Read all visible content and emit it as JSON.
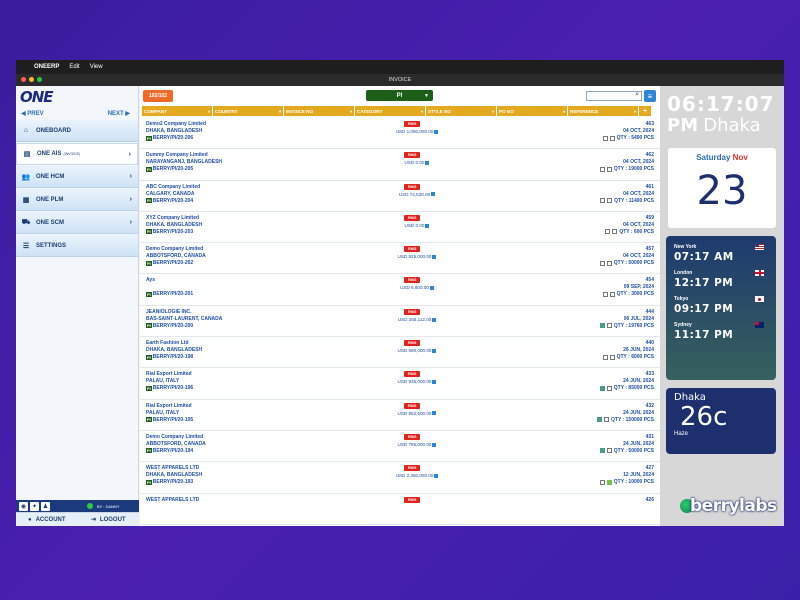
{
  "menubar": {
    "apple": "",
    "app": "ONEERP",
    "items": [
      "Edit",
      "View"
    ]
  },
  "window": {
    "title": "INVOICE"
  },
  "sidebar": {
    "logo": "ONE",
    "prev": "◀ PREV",
    "next": "NEXT ▶",
    "items": [
      {
        "label": "ONEBOARD",
        "icon": "home-icon"
      },
      {
        "label": "ONE AIS",
        "sub": "(INVOICE)",
        "icon": "document-icon"
      },
      {
        "label": "ONE HCM",
        "icon": "people-icon"
      },
      {
        "label": "ONE PLM",
        "icon": "factory-icon"
      },
      {
        "label": "ONE SCM",
        "icon": "truck-icon"
      },
      {
        "label": "SETTINGS",
        "icon": "sliders-icon"
      }
    ],
    "user": "BY : DANNY",
    "account": "ACCOUNT",
    "logout": "LOGOUT"
  },
  "toolbar": {
    "count": "102/102",
    "type": "PI",
    "search_placeholder": ""
  },
  "columns": [
    "COMPANY",
    "COUNTRY",
    "INVOICE NO",
    "CATEGORY",
    "STYLE NO",
    "PO NO",
    "REFERENCE"
  ],
  "rows": [
    {
      "company": "Demo2 Company Limited",
      "city": "DHAKA, BANGLADESH",
      "ref": "BERRY/PI/20-206",
      "badge": "RMG",
      "amount": "USD 1,080,000.00",
      "num": "463",
      "date": "04 OCT, 2024",
      "qty": "QTY : 5400 PCS",
      "status": [
        "",
        ""
      ]
    },
    {
      "company": "Dummy Company Limited",
      "city": "NARAYANGANJ, BANGLADESH",
      "ref": "BERRY/PI/20-205",
      "badge": "RMG",
      "amount": "USD 0.00",
      "num": "462",
      "date": "04 OCT, 2024",
      "qty": "QTY : 19000 PCS",
      "status": [
        "",
        ""
      ]
    },
    {
      "company": "ABC Company Limited",
      "city": "CALGARY, CANADA",
      "ref": "BERRY/PI/20-204",
      "badge": "RMG",
      "amount": "USD 74,530.00",
      "num": "461",
      "date": "04 OCT, 2024",
      "qty": "QTY : 11400 PCS",
      "status": [
        "",
        ""
      ]
    },
    {
      "company": "XYZ Company Limited",
      "city": "DHAKA, BANGLADESH",
      "ref": "BERRY/PI/20-203",
      "badge": "RMG",
      "amount": "USD 0.00",
      "num": "459",
      "date": "04 OCT, 2024",
      "qty": "QTY : 600 PCS",
      "status": [
        "",
        ""
      ]
    },
    {
      "company": "Demo Company Limited",
      "city": "ABBOTSFORD, CANADA",
      "ref": "BERRY/PI/20-202",
      "badge": "RMG",
      "amount": "USD 825,000.00",
      "num": "457",
      "date": "04 OCT, 2024",
      "qty": "QTY : 50000 PCS",
      "status": [
        "",
        ""
      ]
    },
    {
      "company": "Ays",
      "city": "",
      "ref": "BERRY/PI/20-201",
      "badge": "RMG",
      "amount": "USD 6,600.00",
      "num": "454",
      "date": "09 SEP, 2024",
      "qty": "QTY : 3000 PCS",
      "status": [
        "",
        ""
      ]
    },
    {
      "company": "JEANIOLOGIE INC.",
      "city": "BAS-SAINT-LAURENT, CANADA",
      "ref": "BERRY/PI/20-200",
      "badge": "RMG",
      "amount": "USD 255,112.00",
      "num": "444",
      "date": "06 JUL, 2024",
      "qty": "QTY : 19760 PCS",
      "status": [
        "teal",
        ""
      ]
    },
    {
      "company": "Earth Fashion Ltd",
      "city": "DHAKA, BANGLADESH",
      "ref": "BERRY/PI/20-198",
      "badge": "RMG",
      "amount": "USD 690,000.00",
      "num": "440",
      "date": "26 JUN, 2024",
      "qty": "QTY : 6000 PCS",
      "status": [
        "",
        ""
      ]
    },
    {
      "company": "Rial Export Limited",
      "city": "PALAU, ITALY",
      "ref": "BERRY/PI/20-196",
      "badge": "RMG",
      "amount": "USD 935,000.00",
      "num": "433",
      "date": "24 JUN, 2024",
      "qty": "QTY : 85000 PCS",
      "status": [
        "teal",
        ""
      ]
    },
    {
      "company": "Rial Export Limited",
      "city": "PALAU, ITALY",
      "ref": "BERRY/PI/20-195",
      "badge": "RMG",
      "amount": "USD 862,500.00",
      "num": "432",
      "date": "24 JUN, 2024",
      "qty": "QTY : 150000 PCS",
      "status": [
        "teal",
        ""
      ]
    },
    {
      "company": "Demo Company Limited",
      "city": "ABBOTSFORD, CANADA",
      "ref": "BERRY/PI/20-194",
      "badge": "RMG",
      "amount": "USD 785,000.00",
      "num": "431",
      "date": "24 JUN, 2024",
      "qty": "QTY : 50000 PCS",
      "status": [
        "teal",
        ""
      ]
    },
    {
      "company": "WEST APPARELS LTD",
      "city": "DHAKA, BANGLADESH",
      "ref": "BERRY/PI/20-193",
      "badge": "RMG",
      "amount": "USD 2,350,000.00",
      "num": "427",
      "date": "12 JUN, 2024",
      "qty": "QTY : 10000 PCS",
      "status": [
        "",
        "green"
      ]
    },
    {
      "company": "WEST APPARELS LTD",
      "city": "",
      "ref": "",
      "badge": "RMG",
      "amount": "",
      "num": "426",
      "date": "",
      "qty": "",
      "status": [
        "",
        ""
      ]
    }
  ],
  "clock": {
    "time": "06:17:07",
    "ampm": "PM",
    "city": "Dhaka"
  },
  "calendar": {
    "weekday": "Saturday",
    "month": "Nov",
    "date": "23"
  },
  "world_clocks": [
    {
      "city": "New York",
      "time": "07:17 AM",
      "flag": "us"
    },
    {
      "city": "London",
      "time": "12:17 PM",
      "flag": "uk"
    },
    {
      "city": "Tokyo",
      "time": "09:17 PM",
      "flag": "jp"
    },
    {
      "city": "Sydney",
      "time": "11:17 PM",
      "flag": "au"
    }
  ],
  "weather": {
    "city": "Dhaka",
    "temp": "26c",
    "condition": "Haze"
  },
  "brand": "berrylabs"
}
